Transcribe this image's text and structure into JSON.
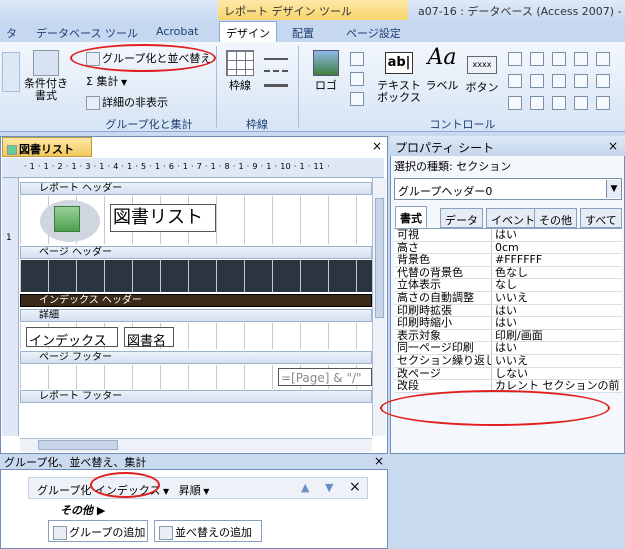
{
  "window": {
    "left_cut": "タ",
    "context_tool": "レポート デザイン ツール",
    "title": "a07-16 : データベース (Access 2007) -"
  },
  "tabs": [
    "データベース ツール",
    "Acrobat",
    "デザイン",
    "配置",
    "ページ設定"
  ],
  "ribbon": {
    "group_btn": "グループ化と並べ替え",
    "sum_btn": "集計",
    "hide_btn": "詳細の非表示",
    "cond_fmt": "条件付き\n書式",
    "group_label": "グループ化と集計",
    "border_label": "枠線",
    "border_btn": "枠線",
    "logo_btn": "ロゴ",
    "textbox_btn": "テキスト\nボックス",
    "label_btn": "ラベル",
    "button_btn": "ボタン",
    "control_label": "コントロール",
    "abl": "ab|",
    "aa": "Aa",
    "xxxx": "xxxx"
  },
  "report": {
    "tab_title": "図書リスト",
    "ruler": "· 1 · 1 · 2 · 1 · 3 · 1 · 4 · 1 · 5 · 1 · 6 · 1 · 7 · 1 · 8 · 1 · 9 · 1 · 10 · 1 · 11 ·",
    "vruler_1": "1",
    "sections": {
      "report_header": "レポート ヘッダー",
      "page_header": "ページ ヘッダー",
      "index_header": "インデックス ヘッダー",
      "detail": "詳細",
      "page_footer": "ページ フッター",
      "report_footer": "レポート フッター"
    },
    "title_field": "図書リスト",
    "index_field": "インデックス",
    "bookname_field": "図書名",
    "page_expr": "=[Page] & \"/\""
  },
  "property_sheet": {
    "title": "プロパティ シート",
    "selection_type": "選択の種類: セクション",
    "selected": "グループヘッダー0",
    "tabs": [
      "書式",
      "データ",
      "イベント",
      "その他",
      "すべて"
    ],
    "rows": [
      [
        "可視",
        "はい"
      ],
      [
        "高さ",
        "0cm"
      ],
      [
        "背景色",
        "#FFFFFF"
      ],
      [
        "代替の背景色",
        "色なし"
      ],
      [
        "立体表示",
        "なし"
      ],
      [
        "高さの自動調整",
        "いいえ"
      ],
      [
        "印刷時拡張",
        "はい"
      ],
      [
        "印刷時縮小",
        "はい"
      ],
      [
        "表示対象",
        "印刷/画面"
      ],
      [
        "同一ページ印刷",
        "はい"
      ],
      [
        "セクション繰り返し",
        "いいえ"
      ],
      [
        "改ページ",
        "しない"
      ],
      [
        "改段",
        "カレント セクションの前"
      ]
    ]
  },
  "grouping": {
    "title": "グループ化、並べ替え、集計",
    "group_prefix": "グループ化",
    "group_field": "インデックス",
    "order": "昇順",
    "more": "その他 ▶",
    "add_group": "グループの追加",
    "add_sort": "並べ替えの追加"
  },
  "close_glyph": "×",
  "colors": {
    "accent": "#e02020",
    "dark_section": "#3a2a17"
  }
}
